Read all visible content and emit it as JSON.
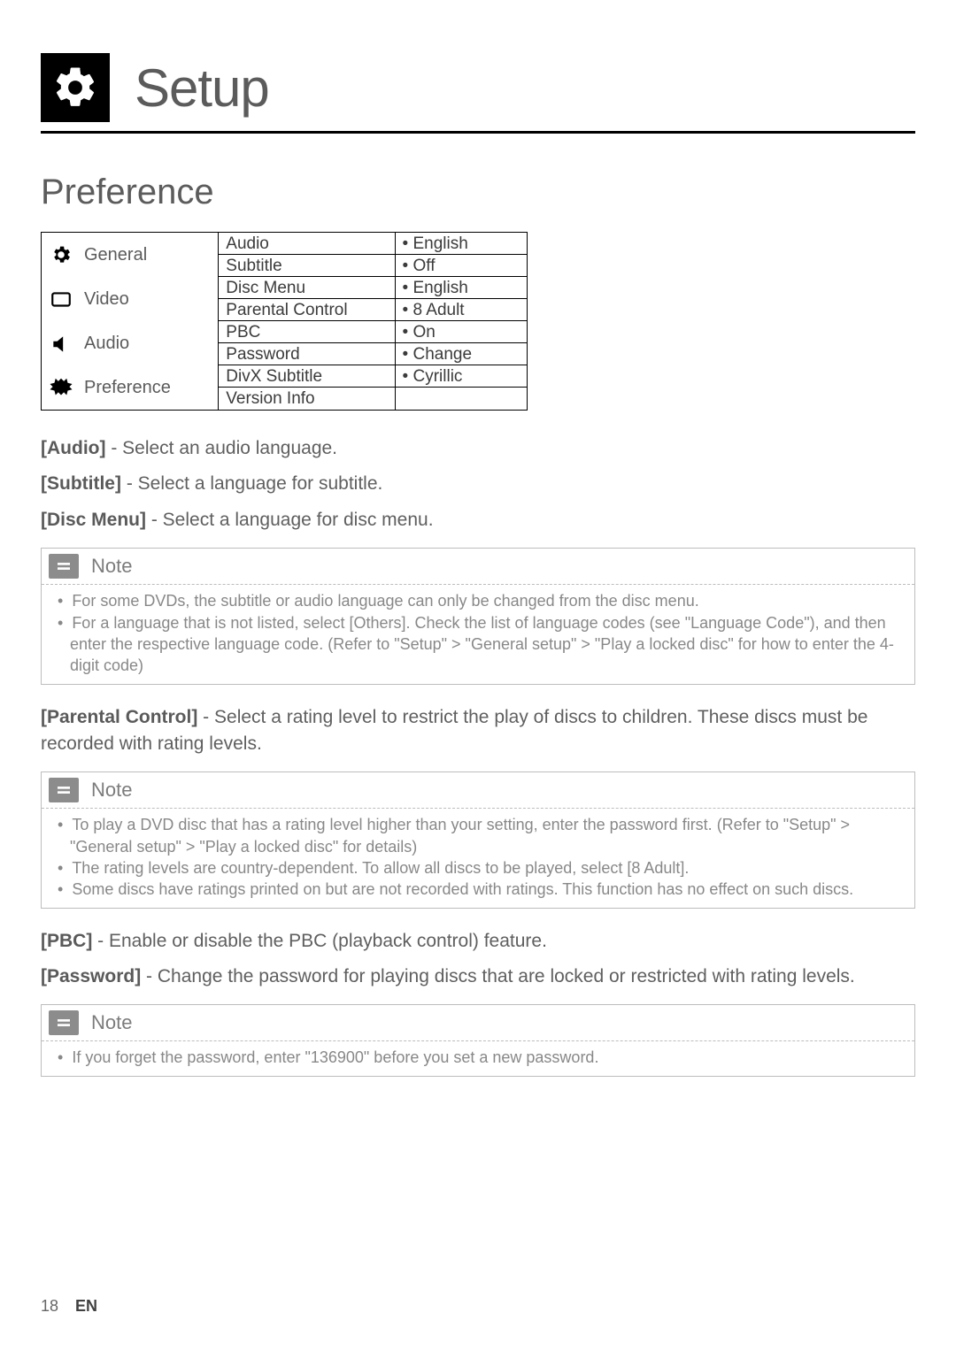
{
  "header": {
    "title": "Setup",
    "icon": "gear-icon"
  },
  "section": {
    "title": "Preference"
  },
  "menu": {
    "left": [
      {
        "icon": "gear-icon",
        "label": "General"
      },
      {
        "icon": "monitor-icon",
        "label": "Video"
      },
      {
        "icon": "speaker-icon",
        "label": "Audio"
      },
      {
        "icon": "preference-icon",
        "label": "Preference"
      }
    ],
    "settings": [
      {
        "name": "Audio",
        "value": "• English"
      },
      {
        "name": "Subtitle",
        "value": "• Off"
      },
      {
        "name": "Disc Menu",
        "value": "• English"
      },
      {
        "name": "Parental Control",
        "value": "• 8 Adult"
      },
      {
        "name": "PBC",
        "value": "• On"
      },
      {
        "name": "Password",
        "value": "• Change"
      },
      {
        "name": "DivX Subtitle",
        "value": "• Cyrillic"
      },
      {
        "name": "Version Info",
        "value": ""
      }
    ]
  },
  "descriptions": {
    "audio": {
      "label": "[Audio]",
      "text": " - Select an audio language."
    },
    "subtitle": {
      "label": "[Subtitle]",
      "text": " - Select a language for subtitle."
    },
    "discmenu": {
      "label": "[Disc Menu]",
      "text": " - Select a language for disc menu."
    },
    "parental": {
      "label": "[Parental Control]",
      "text": " - Select a rating level to restrict the play of discs to children. These discs must be recorded with rating levels."
    },
    "pbc": {
      "label": "[PBC]",
      "text": " - Enable or disable the PBC (playback control) feature."
    },
    "password": {
      "label": "[Password]",
      "text": " - Change the password for playing discs that are locked or restricted with rating levels."
    }
  },
  "notes": {
    "label": "Note",
    "note1": {
      "items": [
        "For some DVDs, the subtitle or audio language can only be changed from the disc menu.",
        "For a language that is not listed, select [Others]. Check the list of language codes (see \"Language Code\"), and then enter the respective language code. (Refer to \"Setup\" > \"General setup\" > \"Play a locked disc\" for how to enter the 4-digit code)"
      ]
    },
    "note2": {
      "items": [
        "To play a DVD disc that has a rating level higher than your setting, enter the password first. (Refer to \"Setup\" > \"General setup\" > \"Play a locked disc\" for details)",
        "The rating levels are country-dependent. To allow all discs to be played, select [8 Adult].",
        "Some discs have ratings printed on but are not recorded with ratings. This function has no effect on such discs."
      ]
    },
    "note3": {
      "items": [
        "If you forget the password, enter \"136900\" before you set a new password."
      ]
    }
  },
  "footer": {
    "page": "18",
    "lang": "EN"
  }
}
